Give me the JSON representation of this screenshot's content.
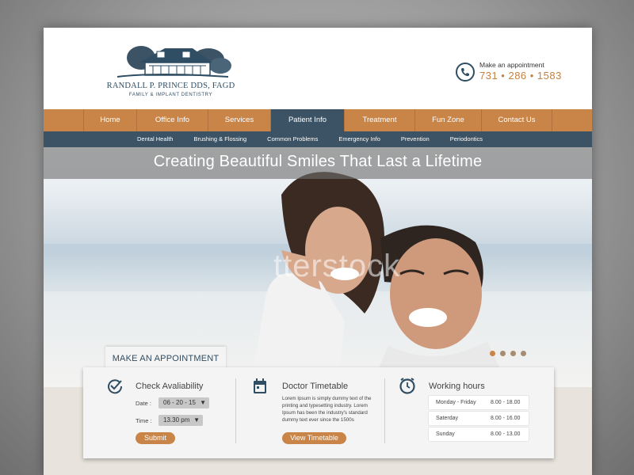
{
  "logo": {
    "name": "RANDALL P. PRINCE DDS, FAGD",
    "subtitle": "FAMILY & IMPLANT DENTISTRY"
  },
  "header": {
    "appointment_label": "Make an appointment",
    "phone": "731 • 286 • 1583"
  },
  "nav": {
    "items": [
      {
        "label": "Home"
      },
      {
        "label": "Office Info"
      },
      {
        "label": "Services"
      },
      {
        "label": "Patient Info"
      },
      {
        "label": "Treatment"
      },
      {
        "label": "Fun Zone"
      },
      {
        "label": "Contact Us"
      }
    ],
    "active": "Patient Info"
  },
  "subnav": {
    "items": [
      {
        "label": "Dental Health"
      },
      {
        "label": "Brushing & Flossing"
      },
      {
        "label": "Common Problems"
      },
      {
        "label": "Emergency Info"
      },
      {
        "label": "Prevention"
      },
      {
        "label": "Periodontics"
      }
    ]
  },
  "hero": {
    "title": "Creating Beautiful Smiles That Last a Lifetime",
    "watermark": "tterstock",
    "slides": 4,
    "active_slide": 1
  },
  "appointment": {
    "tab_label": "MAKE AN APPOINTMENT",
    "check": {
      "title": "Check Avaliability",
      "date_label": "Date :",
      "date_value": "06 - 20 - 15",
      "time_label": "Time :",
      "time_value": "13.30 pm",
      "submit_label": "Submit"
    },
    "timetable": {
      "title": "Doctor Timetable",
      "description": "Lorem Ipsum is simply dummy text of the printing and typesetting industry. Lorem Ipsum has been the industry's standard dummy text ever since the 1500s",
      "button_label": "View Timetable"
    },
    "hours": {
      "title": "Working hours",
      "rows": [
        {
          "day": "Monday - Friday",
          "time": "8.00 - 18.00"
        },
        {
          "day": "Saterday",
          "time": "8.00 - 16.00"
        },
        {
          "day": "Sunday",
          "time": "8.00 - 13.00"
        }
      ]
    }
  },
  "colors": {
    "accent": "#c98447",
    "navy": "#3b5365",
    "text": "#2f4d63"
  }
}
